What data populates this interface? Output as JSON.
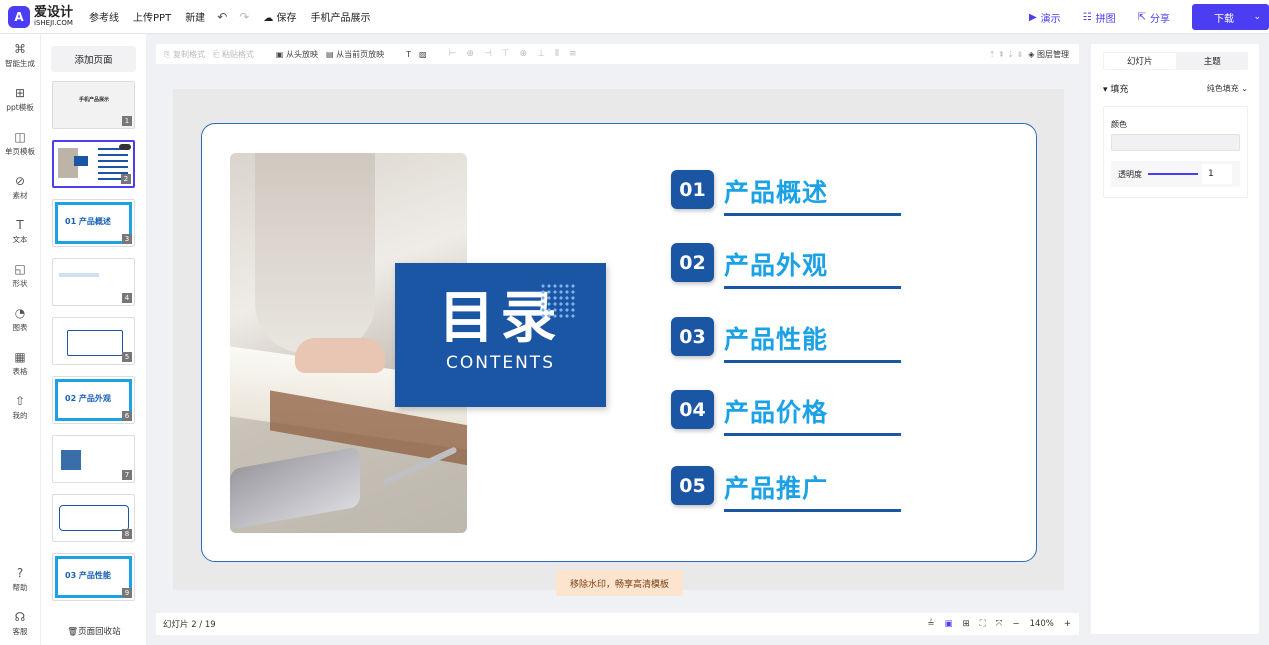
{
  "header": {
    "logo_cn": "爱设计",
    "logo_en": "iSHEJI.COM",
    "menu": [
      "参考线",
      "上传PPT",
      "新建"
    ],
    "save": "保存",
    "doc_title": "手机产品展示",
    "present": "演示",
    "collage": "拼图",
    "share": "分享",
    "download": "下载"
  },
  "leftnav": [
    {
      "label": "智能生成",
      "icon": "ai-icon"
    },
    {
      "label": "ppt模板",
      "icon": "ppt-template-icon"
    },
    {
      "label": "单页模板",
      "icon": "page-template-icon"
    },
    {
      "label": "素材",
      "icon": "material-icon"
    },
    {
      "label": "文本",
      "icon": "text-icon"
    },
    {
      "label": "形状",
      "icon": "shape-icon"
    },
    {
      "label": "图表",
      "icon": "chart-icon"
    },
    {
      "label": "表格",
      "icon": "table-icon"
    },
    {
      "label": "我的",
      "icon": "upload-icon"
    },
    {
      "label": "帮助",
      "icon": "help-icon"
    },
    {
      "label": "客服",
      "icon": "headset-icon"
    }
  ],
  "thumbnails": {
    "add_page": "添加页面",
    "recycle": "页面回收站",
    "items": [
      {
        "num": "1",
        "label": "手机产品展示"
      },
      {
        "num": "2",
        "label": "目录"
      },
      {
        "num": "3",
        "label": "01 产品概述"
      },
      {
        "num": "4",
        "label": ""
      },
      {
        "num": "5",
        "label": ""
      },
      {
        "num": "6",
        "label": "02 产品外观"
      },
      {
        "num": "7",
        "label": ""
      },
      {
        "num": "8",
        "label": ""
      },
      {
        "num": "9",
        "label": "03 产品性能"
      }
    ]
  },
  "toolbar": {
    "copy_format": "复制格式",
    "paste_format": "粘贴格式",
    "play_from_start": "从头放映",
    "play_from_current": "从当前页放映",
    "layer_manage": "图层管理"
  },
  "slide": {
    "title_cn": "目录",
    "title_en": "CONTENTS",
    "items": [
      {
        "num": "01",
        "text": "产品概述"
      },
      {
        "num": "02",
        "text": "产品外观"
      },
      {
        "num": "03",
        "text": "产品性能"
      },
      {
        "num": "04",
        "text": "产品价格"
      },
      {
        "num": "05",
        "text": "产品推广"
      }
    ]
  },
  "watermark_tip": "移除水印，畅享高清模板",
  "status": {
    "page": "幻灯片 2 / 19",
    "zoom": "140%"
  },
  "rightpanel": {
    "tabs": [
      "幻灯片",
      "主题"
    ],
    "fill_label": "填充",
    "fill_value": "纯色填充",
    "color_label": "颜色",
    "opacity_label": "透明度",
    "opacity_value": "1"
  }
}
